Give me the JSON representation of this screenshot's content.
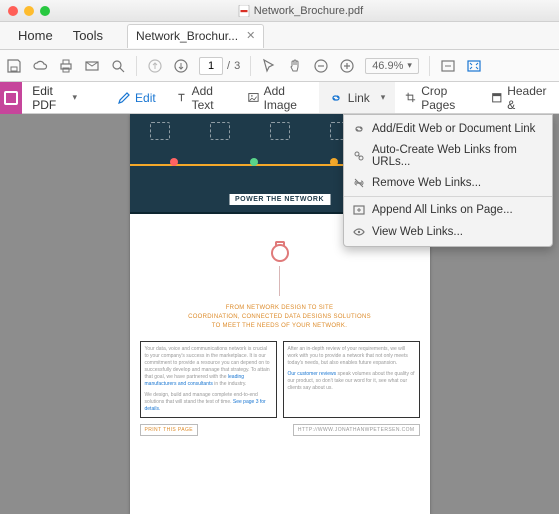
{
  "window": {
    "title": "Network_Brochure.pdf"
  },
  "tabs": {
    "home": "Home",
    "tools": "Tools",
    "doc": "Network_Brochur..."
  },
  "toolbar": {
    "page": {
      "current": "1",
      "sep": "/",
      "total": "3"
    },
    "zoom": "46.9%"
  },
  "editbar": {
    "title": "Edit PDF",
    "edit": "Edit",
    "add_text": "Add Text",
    "add_image": "Add Image",
    "link": "Link",
    "crop": "Crop Pages",
    "header": "Header &"
  },
  "menu": {
    "items": [
      "Add/Edit Web or Document Link",
      "Auto-Create Web Links from URLs...",
      "Remove Web Links...",
      "Append All Links on Page...",
      "View Web Links..."
    ]
  },
  "page": {
    "hero_badge": "POWER THE NETWORK",
    "heading_l1": "FROM NETWORK DESIGN TO SITE",
    "heading_l2": "COORDINATION, CONNECTED DATA DESIGNS SOLUTIONS",
    "heading_l3": "TO MEET THE NEEDS OF YOUR NETWORK.",
    "left_text_1": "Your data, voice and communications network is crucial to your company's success in the marketplace. It is our commitment to provide a resource you can depend on to successfully develop and manage that strategy. To attain that goal, we have partnered with the ",
    "left_link": "leading manufacturers and consultants",
    "left_text_2": " in the industry.",
    "left_para2_1": "We design, build and manage complete end-to-end solutions that will stand the test of time. ",
    "left_para2_link": "See page 3 for details.",
    "right_text_1": "After an in-depth review of your requirements, we will work with you to provide a network that not only meets today's needs, but also enables future expansion.",
    "right_link": "Our customer reviews",
    "right_text_2": " speak volumes about the quality of our product, so don't take our word for it, see what our clients say about us.",
    "foot_left": "PRINT THIS PAGE",
    "foot_right": "HTTP://WWW.JONATHANWPETERSEN.COM"
  }
}
